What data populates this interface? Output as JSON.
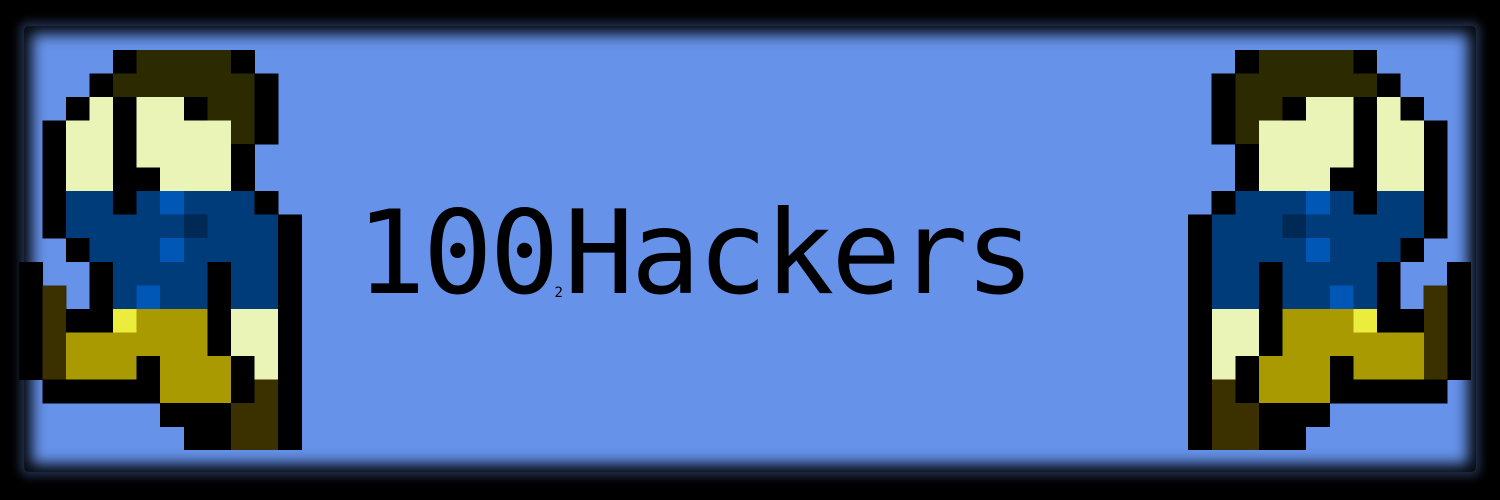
{
  "banner": {
    "title_number": "100",
    "title_subscript": "2",
    "title_word": "Hackers"
  },
  "colors": {
    "background": "#6692ea",
    "border": "#000000",
    "hair": "#2b2a00",
    "skin": "#eaf4b6",
    "shirt": "#003b7a",
    "shirt_light": "#0057b5",
    "shirt_dark": "#002a55",
    "belt": "#ecec3c",
    "pants": "#a89a00",
    "shoes": "#3b3000",
    "outline": "#000000"
  },
  "icons": {
    "left_character": "running-hacker-sprite",
    "right_character": "running-hacker-sprite-mirrored"
  }
}
